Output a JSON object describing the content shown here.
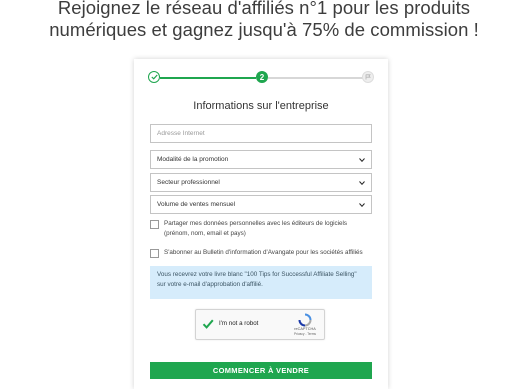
{
  "headline": {
    "line1": "Rejoignez le réseau d'affiliés n°1 pour les produits",
    "line2": "numériques et gagnez jusqu'à 75% de commission !"
  },
  "stepper": {
    "current_step": 2,
    "steps": [
      {
        "label": "",
        "state": "done",
        "icon": "check-icon"
      },
      {
        "label": "2",
        "state": "current"
      },
      {
        "label": "",
        "state": "todo",
        "icon": "flag-icon"
      }
    ],
    "accent": "#1fa64f"
  },
  "form": {
    "title": "Informations sur l'entreprise",
    "website_placeholder": "Adresse Internet",
    "promotion_select": "Modalité de la promotion",
    "sector_select": "Secteur professionnel",
    "sales_select": "Volume de ventes mensuel",
    "consent_share": "Partager mes données personnelles avec les éditeurs de logiciels (prénom, nom, email et pays)",
    "consent_newsletter": "S'abonner au Bulletin d'information d'Avangate pour les sociétés affiliés",
    "info_text": "Vous recevrez votre livre blanc \"100 Tips for Successful Affiliate Selling\" sur votre e-mail d'approbation d'affilié.",
    "submit_label": "COMMENCER À VENDRE"
  },
  "captcha": {
    "label": "I'm not a robot",
    "brand": "reCAPTCHA",
    "links": "Privacy - Terms",
    "checked": true
  }
}
